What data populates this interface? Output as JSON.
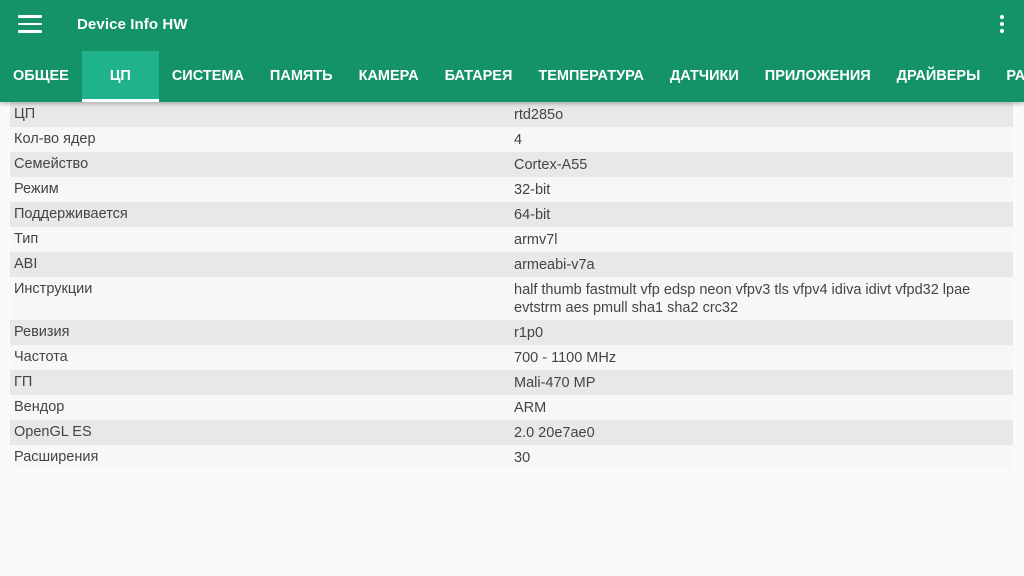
{
  "app": {
    "title": "Device Info HW"
  },
  "colors": {
    "appbar": "#149369",
    "active_tab": "#1fb28b",
    "text_on_bar": "#ffffff"
  },
  "tabs": [
    {
      "label": "ОБЩЕЕ",
      "active": false
    },
    {
      "label": "ЦП",
      "active": true
    },
    {
      "label": "СИСТЕМА",
      "active": false
    },
    {
      "label": "ПАМЯТЬ",
      "active": false
    },
    {
      "label": "КАМЕРА",
      "active": false
    },
    {
      "label": "БАТАРЕЯ",
      "active": false
    },
    {
      "label": "ТЕМПЕРАТУРА",
      "active": false
    },
    {
      "label": "ДАТЧИКИ",
      "active": false
    },
    {
      "label": "ПРИЛОЖЕНИЯ",
      "active": false
    },
    {
      "label": "ДРАЙВЕРЫ",
      "active": false
    },
    {
      "label": "РАЗМ",
      "active": false
    }
  ],
  "rows": [
    {
      "key": "ЦП",
      "value": "rtd285o"
    },
    {
      "key": "Кол-во ядер",
      "value": "4"
    },
    {
      "key": "Семейство",
      "value": "Cortex-A55"
    },
    {
      "key": "Режим",
      "value": "32-bit"
    },
    {
      "key": "Поддерживается",
      "value": "64-bit"
    },
    {
      "key": "Тип",
      "value": "armv7l"
    },
    {
      "key": "ABI",
      "value": "armeabi-v7a"
    },
    {
      "key": "Инструкции",
      "value": "half thumb fastmult vfp edsp neon vfpv3 tls vfpv4 idiva idivt vfpd32 lpae evtstrm aes pmull sha1 sha2 crc32"
    },
    {
      "key": "Ревизия",
      "value": "r1p0"
    },
    {
      "key": "Частота",
      "value": "700 - 1100 MHz"
    },
    {
      "key": "ГП",
      "value": "Mali-470 MP"
    },
    {
      "key": "Вендор",
      "value": "ARM"
    },
    {
      "key": "OpenGL ES",
      "value": "2.0 20e7ae0"
    },
    {
      "key": "Расширения",
      "value": "30"
    }
  ]
}
